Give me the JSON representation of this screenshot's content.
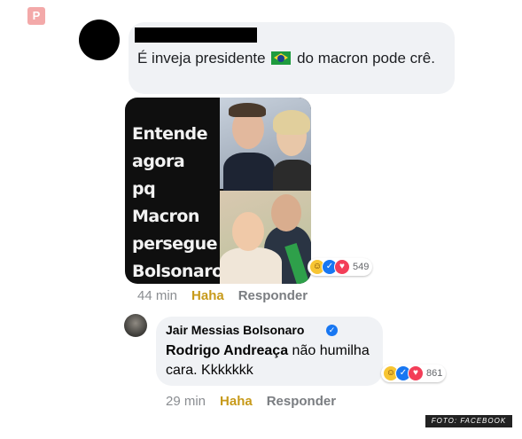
{
  "pin_icon": "pinterest-icon",
  "comment1": {
    "text_before": "É inveja presidente",
    "text_after": "do macron pode crê.",
    "flag_icon": "brazil-flag-icon",
    "meme_lines": [
      "Entende",
      "agora",
      "pq Macron",
      "persegue",
      "Bolsonaro?"
    ],
    "reaction_count": "549",
    "time": "44 min",
    "haha": "Haha",
    "reply": "Responder"
  },
  "reply1": {
    "name": "Jair Messias Bolsonaro",
    "mention": "Rodrigo Andreaça",
    "text": "não humilha cara. Kkkkkkk",
    "reaction_count": "861",
    "time": "29 min",
    "haha": "Haha",
    "reply": "Responder"
  },
  "credit": "FOTO: FACEBOOK",
  "colors": {
    "bubble": "#f0f2f5",
    "haha": "#c79a1a",
    "like": "#1877f2",
    "love": "#f33e58"
  }
}
